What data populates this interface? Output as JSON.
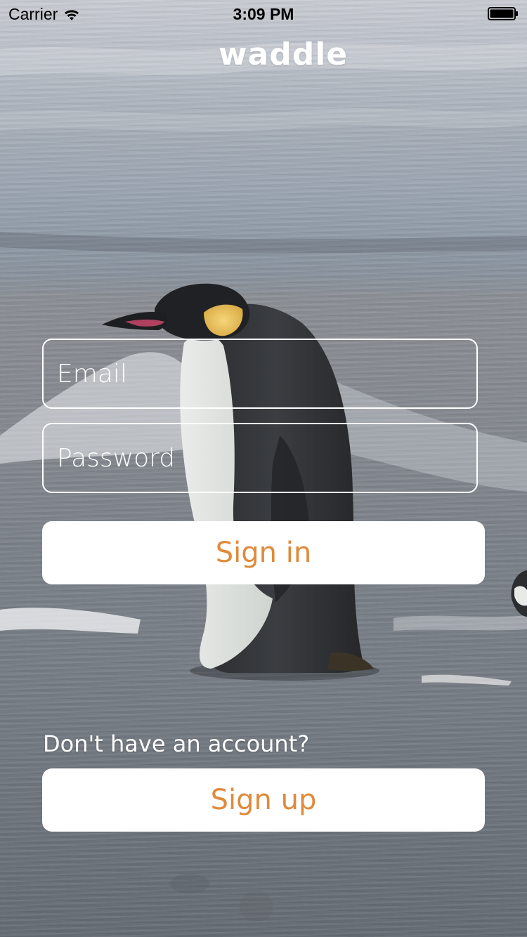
{
  "status_bar": {
    "carrier": "Carrier",
    "time": "3:09 PM",
    "wifi_icon": "wifi-icon",
    "battery_icon": "battery-icon"
  },
  "app": {
    "title": "waddle"
  },
  "login_form": {
    "email_placeholder": "Email",
    "password_placeholder": "Password",
    "sign_in_label": "Sign in"
  },
  "signup": {
    "prompt": "Don't have an account?",
    "sign_up_label": "Sign up"
  },
  "colors": {
    "accent": "#e08a3c",
    "button_bg": "#ffffff",
    "text_on_photo": "#ffffff"
  }
}
